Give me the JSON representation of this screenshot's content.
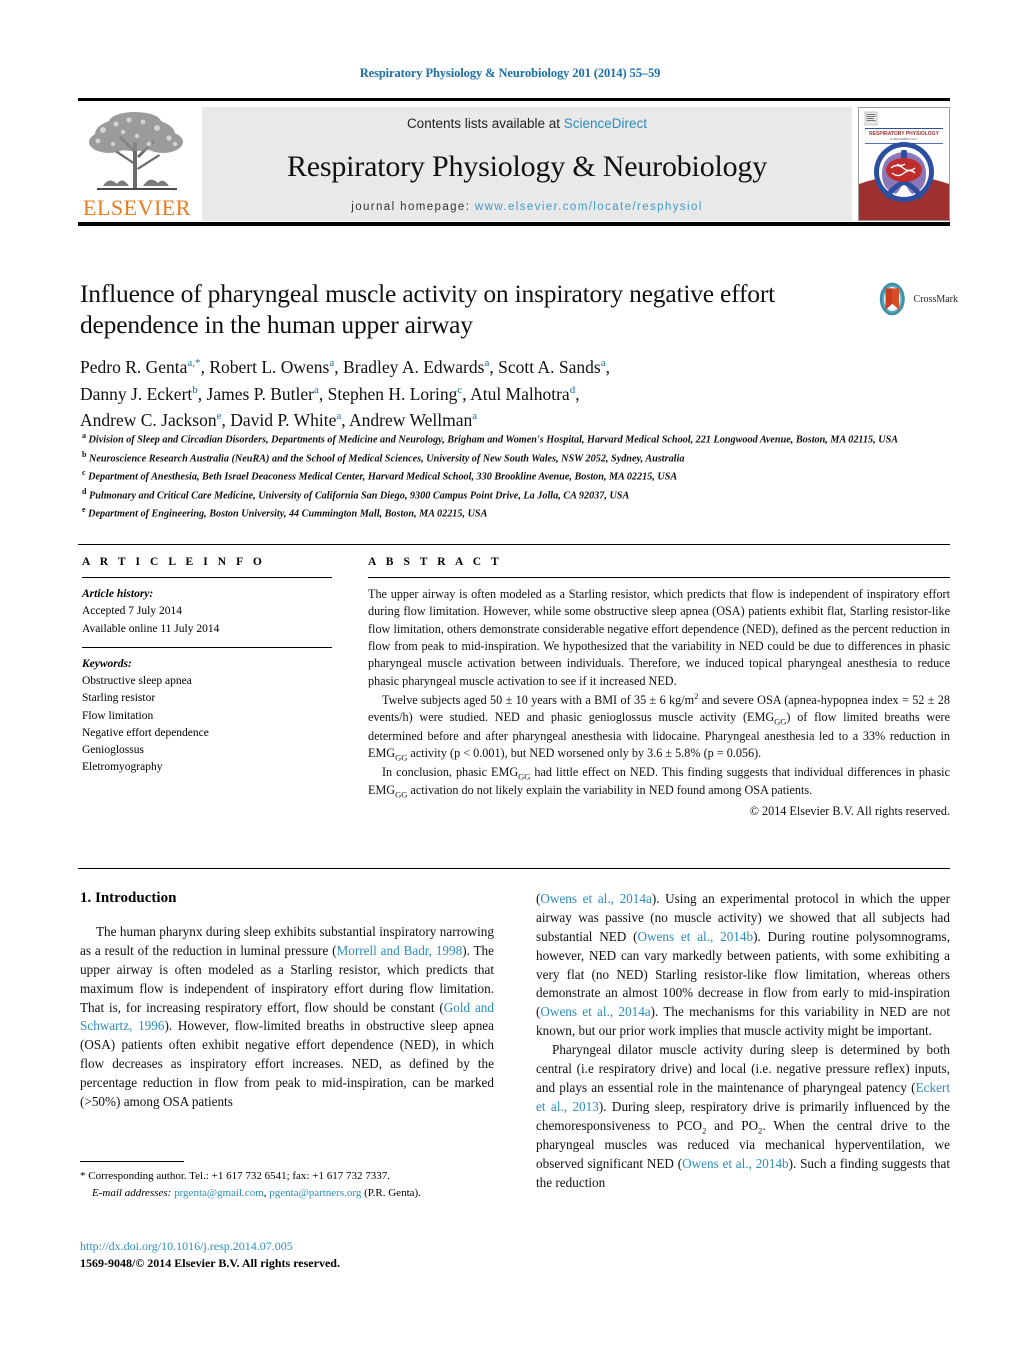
{
  "running_head": "Respiratory Physiology & Neurobiology 201 (2014) 55–59",
  "masthead": {
    "publisher_name": "ELSEVIER",
    "contents_prefix": "Contents lists available at ",
    "contents_link": "ScienceDirect",
    "journal_title": "Respiratory Physiology & Neurobiology",
    "homepage_prefix": "journal homepage: ",
    "homepage_url": "www.elsevier.com/locate/resphysiol",
    "cover_title": "RESPIRATORY PHYSIOLOGY & NEUROBIOLOGY"
  },
  "article": {
    "title": "Influence of pharyngeal muscle activity on inspiratory negative effort dependence in the human upper airway",
    "crossmark_label": "CrossMark",
    "authors_lines": [
      "Pedro R. Genta a,*, Robert L. Owens a, Bradley A. Edwards a, Scott A. Sands a,",
      "Danny J. Eckert b, James P. Butler a, Stephen H. Loring c, Atul Malhotra d,",
      "Andrew C. Jackson e, David P. White a, Andrew Wellman a"
    ],
    "authors": [
      {
        "name": "Pedro R. Genta",
        "sup": "a,*"
      },
      {
        "name": "Robert L. Owens",
        "sup": "a"
      },
      {
        "name": "Bradley A. Edwards",
        "sup": "a"
      },
      {
        "name": "Scott A. Sands",
        "sup": "a"
      },
      {
        "name": "Danny J. Eckert",
        "sup": "b"
      },
      {
        "name": "James P. Butler",
        "sup": "a"
      },
      {
        "name": "Stephen H. Loring",
        "sup": "c"
      },
      {
        "name": "Atul Malhotra",
        "sup": "d"
      },
      {
        "name": "Andrew C. Jackson",
        "sup": "e"
      },
      {
        "name": "David P. White",
        "sup": "a"
      },
      {
        "name": "Andrew Wellman",
        "sup": "a"
      }
    ],
    "affiliations": [
      {
        "sup": "a",
        "text": "Division of Sleep and Circadian Disorders, Departments of Medicine and Neurology, Brigham and Women's Hospital, Harvard Medical School, 221 Longwood Avenue, Boston, MA 02115, USA"
      },
      {
        "sup": "b",
        "text": "Neuroscience Research Australia (NeuRA) and the School of Medical Sciences, University of New South Wales, NSW 2052, Sydney, Australia"
      },
      {
        "sup": "c",
        "text": "Department of Anesthesia, Beth Israel Deaconess Medical Center, Harvard Medical School, 330 Brookline Avenue, Boston, MA 02215, USA"
      },
      {
        "sup": "d",
        "text": "Pulmonary and Critical Care Medicine, University of California San Diego, 9300 Campus Point Drive, La Jolla, CA 92037, USA"
      },
      {
        "sup": "e",
        "text": "Department of Engineering, Boston University, 44 Cummington Mall, Boston, MA 02215, USA"
      }
    ]
  },
  "article_info": {
    "heading": "A R T I C L E  I N F O",
    "history_label": "Article history:",
    "history": [
      "Accepted 7 July 2014",
      "Available online 11 July 2014"
    ],
    "keywords_label": "Keywords:",
    "keywords": [
      "Obstructive sleep apnea",
      "Starling resistor",
      "Flow limitation",
      "Negative effort dependence",
      "Genioglossus",
      "Eletromyography"
    ]
  },
  "abstract": {
    "heading": "A B S T R A C T",
    "paragraph_1": "The upper airway is often modeled as a Starling resistor, which predicts that flow is independent of inspiratory effort during flow limitation. However, while some obstructive sleep apnea (OSA) patients exhibit flat, Starling resistor-like flow limitation, others demonstrate considerable negative effort dependence (NED), defined as the percent reduction in flow from peak to mid-inspiration. We hypothesized that the variability in NED could be due to differences in phasic pharyngeal muscle activation between individuals. Therefore, we induced topical pharyngeal anesthesia to reduce phasic pharyngeal muscle activation to see if it increased NED.",
    "paragraph_2_a": "Twelve subjects aged 50 ± 10 years with a BMI of 35 ± 6 kg/m",
    "paragraph_2_sup": "2",
    "paragraph_2_b": " and severe OSA (apnea-hypopnea index = 52 ± 28 events/h) were studied. NED and phasic genioglossus muscle activity (EMG",
    "paragraph_2_sub": "GG",
    "paragraph_2_c": ") of flow limited breaths were determined before and after pharyngeal anesthesia with lidocaine. Pharyngeal anesthesia led to a 33% reduction in EMG",
    "paragraph_2_sub2": "GG",
    "paragraph_2_d": " activity (p < 0.001), but NED worsened only by 3.6 ± 5.8% (p = 0.056).",
    "paragraph_3_a": "In conclusion, phasic EMG",
    "paragraph_3_sub": "GG",
    "paragraph_3_b": " had little effect on NED. This finding suggests that individual differences in phasic EMG",
    "paragraph_3_sub2": "GG",
    "paragraph_3_c": " activation do not likely explain the variability in NED found among OSA patients.",
    "copyright": "© 2014 Elsevier B.V. All rights reserved."
  },
  "introduction": {
    "heading": "1.  Introduction",
    "left_p1_a": "The human pharynx during sleep exhibits substantial inspiratory narrowing as a result of the reduction in luminal pressure (",
    "left_ref1": "Morrell and Badr, 1998",
    "left_p1_b": "). The upper airway is often modeled as a Starling resistor, which predicts that maximum flow is independent of inspiratory effort during flow limitation. That is, for increasing respiratory effort, flow should be constant (",
    "left_ref2": "Gold and Schwartz, 1996",
    "left_p1_c": "). However, flow-limited breaths in obstructive sleep apnea (OSA) patients often exhibit negative effort dependence (NED), in which flow decreases as inspiratory effort increases. NED, as defined by the percentage reduction in flow from peak to mid-inspiration, can be marked (>50%) among OSA patients",
    "right_ref1": "Owens et al., 2014a",
    "right_p1_a": "). Using an experimental protocol in which the upper airway was passive (no muscle activity) we showed that all subjects had substantial NED (",
    "right_ref2": "Owens et al., 2014b",
    "right_p1_b": "). During routine polysomnograms, however, NED can vary markedly between patients, with some exhibiting a very flat (no NED) Starling resistor-like flow limitation, whereas others demonstrate an almost 100% decrease in flow from early to mid-inspiration (",
    "right_ref3": "Owens et al., 2014a",
    "right_p1_c": "). The mechanisms for this variability in NED are not known, but our prior work implies that muscle activity might be important.",
    "right_p2_a": "Pharyngeal dilator muscle activity during sleep is determined by both central (i.e respiratory drive) and local (i.e. negative pressure reflex) inputs, and plays an essential role in the maintenance of pharyngeal patency (",
    "right_ref4": "Eckert et al., 2013",
    "right_p2_b": "). During sleep, respiratory drive is primarily influenced by the chemoresponsiveness to PCO",
    "right_p2_sub1": "2",
    "right_p2_c": " and PO",
    "right_p2_sub2": "2",
    "right_p2_d": ". When the central drive to the pharyngeal muscles was reduced via mechanical hyperventilation, we observed significant NED (",
    "right_ref5": "Owens et al., 2014b",
    "right_p2_e": "). Such a finding suggests that the reduction"
  },
  "footnote": {
    "marker": "*",
    "corresponding": "Corresponding author. Tel.: +1 617 732 6541; fax: +1 617 732 7337.",
    "email_label": "E-mail addresses:",
    "email_1": "prgenta@gmail.com",
    "email_sep": ", ",
    "email_2": "pgenta@partners.org",
    "email_suffix": " (P.R. Genta)."
  },
  "footer": {
    "doi": "http://dx.doi.org/10.1016/j.resp.2014.07.005",
    "issn_line": "1569-9048/© 2014 Elsevier B.V. All rights reserved."
  },
  "colors": {
    "link": "#2b8cbe",
    "running_head": "#1b6ea8",
    "elsevier_orange": "#E87B1E",
    "band_gray": "#e9e9e9",
    "cover_red": "#9e3030",
    "cover_blue": "#2b4f9e",
    "cover_purple": "#8a78b8"
  }
}
